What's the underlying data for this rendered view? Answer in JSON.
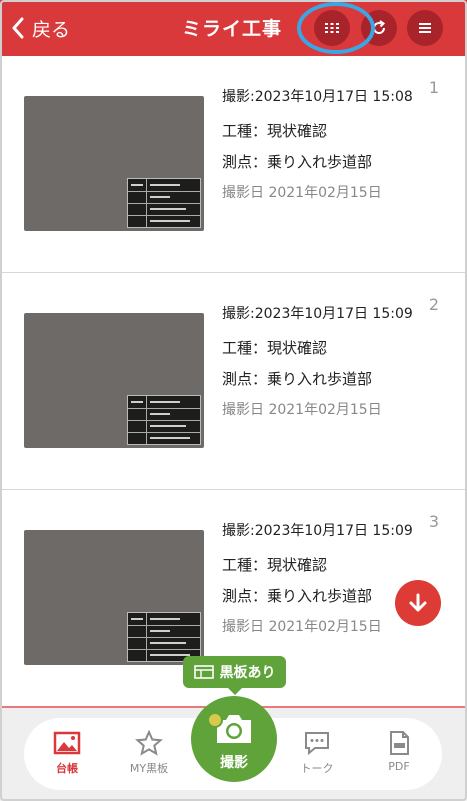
{
  "header": {
    "back_label": "戻る",
    "title": "ミライ工事"
  },
  "photos": [
    {
      "index": "1",
      "shot_time": "撮影:2023年10月17日 15:08",
      "work_type": "工種：現状確認",
      "point": "測点：乗り入れ歩道部",
      "date": "撮影日 2021年02月15日"
    },
    {
      "index": "2",
      "shot_time": "撮影:2023年10月17日 15:09",
      "work_type": "工種：現状確認",
      "point": "測点：乗り入れ歩道部",
      "date": "撮影日 2021年02月15日"
    },
    {
      "index": "3",
      "shot_time": "撮影:2023年10月17日 15:09",
      "work_type": "工種：現状確認",
      "point": "測点：乗り入れ歩道部",
      "date": "撮影日 2021年02月15日"
    }
  ],
  "tooltip": {
    "label": "黒板あり"
  },
  "tabs": {
    "ledger": "台帳",
    "my_board": "MY黒板",
    "shoot": "撮影",
    "talk": "トーク",
    "pdf": "PDF"
  },
  "colors": {
    "brand_red": "#d9393a",
    "accent_green": "#5fa33a",
    "highlight_blue": "#3aa6e6"
  },
  "icons": [
    "chevron-left-icon",
    "grid-icon",
    "refresh-icon",
    "menu-icon",
    "arrow-down-icon",
    "board-icon",
    "image-icon",
    "star-icon",
    "camera-icon",
    "chat-icon",
    "pdf-icon"
  ]
}
